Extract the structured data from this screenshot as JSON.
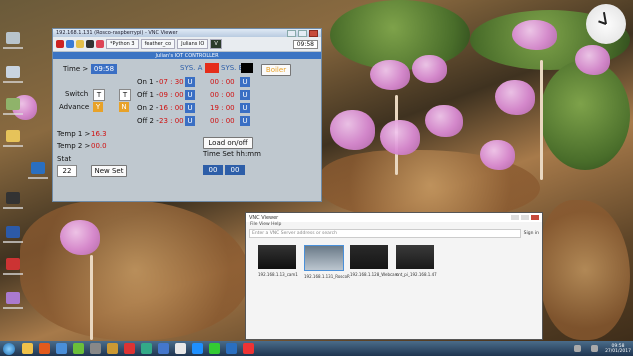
{
  "colors": {
    "accent_blue": "#3a6fc4",
    "readout_red": "#d01010",
    "boiler_orange": "#e8a228",
    "sys_a_swatch": "#e52d1a",
    "sys_b_swatch": "#000000"
  },
  "vnc_window": {
    "titlebar_text": "192.168.1.131 (Rosco-raspberrypi) - VNC Viewer",
    "tabs": [
      "*Python 3",
      "feather_co",
      "Julians IO"
    ],
    "clock": "09:58",
    "app_title": "Julian's IOT CONTROLLER"
  },
  "controller": {
    "time_label": "Time >",
    "time_value": "09:58",
    "sys_a_label": "SYS. A",
    "sys_b_label": "SYS. B",
    "boiler_label": "Boiler",
    "switch_label": "Switch",
    "advance_label": "Advance",
    "switch_t1": "T",
    "switch_t2": "T",
    "advance_y": "Y",
    "advance_n": "N",
    "rows": [
      {
        "label": "On 1 -",
        "a": "07 : 30",
        "b": "00 : 00"
      },
      {
        "label": "Off 1 -",
        "a": "09 : 00",
        "b": "00 : 00"
      },
      {
        "label": "On 2 -",
        "a": "16 : 00",
        "b": "19 : 00"
      },
      {
        "label": "Off 2 -",
        "a": "23 : 00",
        "b": "00 : 00"
      }
    ],
    "u_label": "U",
    "temp1_label": "Temp 1 >",
    "temp1_value": "16.3",
    "temp2_label": "Temp 2 >",
    "temp2_value": "00.0",
    "stat_label": "Stat",
    "stat_value": "22",
    "new_set": "New Set",
    "load_onoff": "Load on/off",
    "timeset_label": "Time Set hh:mm",
    "timeset_h": "00",
    "timeset_m": "00"
  },
  "viewer": {
    "title": "VNC Viewer",
    "menu": "File  View  Help",
    "address_placeholder": "Enter a VNC Server address or search",
    "user": "Sign in",
    "thumbs": [
      "192.168.1.13_cam1",
      "192.168.1.131_RoscoR",
      "192.168.1.128_Webcam",
      "cnt_pi_192.168.1.47"
    ]
  },
  "taskbar": {
    "time": "09:58",
    "date": "27/01/2017"
  },
  "desktop_icons": [
    "recycle-bin",
    "vnc-viewer-icon",
    "computer",
    "network",
    "folder",
    "shortcut",
    "word"
  ]
}
